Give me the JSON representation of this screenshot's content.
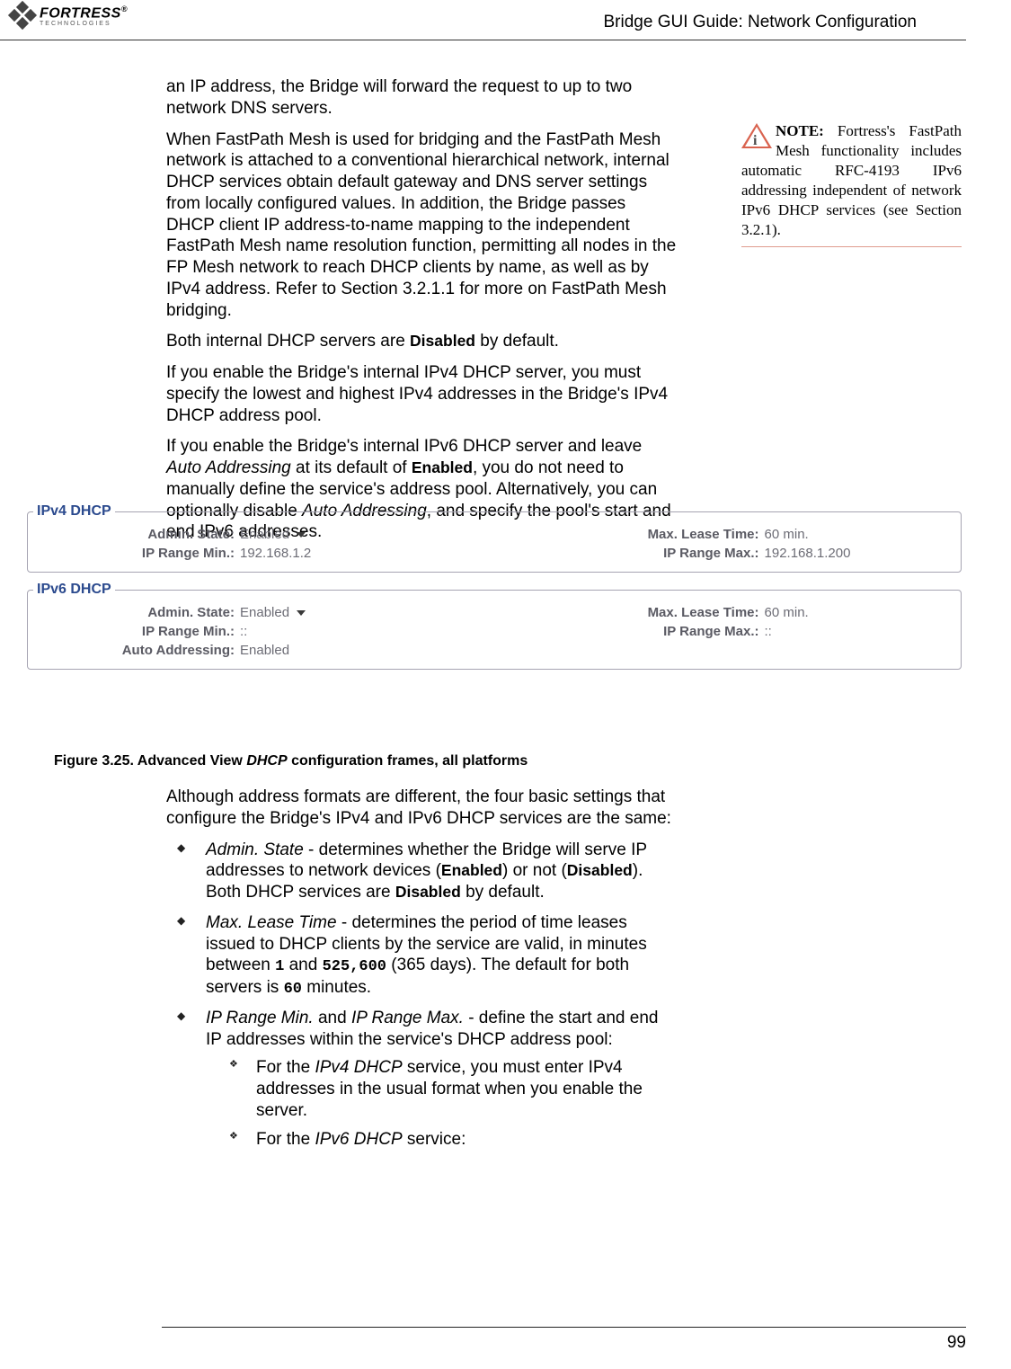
{
  "header": {
    "logo_main": "FORTRESS",
    "logo_sub": "TECHNOLOGIES",
    "title": "Bridge GUI Guide: Network Configuration"
  },
  "body": {
    "p1": "an IP address, the Bridge will forward the request to up to two network DNS servers.",
    "p2": "When FastPath Mesh is used for bridging and the FastPath Mesh network is attached to a conventional hierarchical network, internal DHCP services obtain default gateway and DNS server settings from locally configured values. In addition, the Bridge passes DHCP client IP address-to-name mapping to the independent FastPath Mesh name resolution function, permitting all nodes in the FP Mesh network to reach DHCP clients by name, as well as by IPv4 address. Refer to Section 3.2.1.1 for more on FastPath Mesh bridging.",
    "p3_a": "Both internal DHCP servers are ",
    "p3_b": "Disabled",
    "p3_c": " by default.",
    "p4": "If you enable the Bridge's internal IPv4 DHCP server, you must specify the lowest and highest IPv4 addresses in the Bridge's IPv4 DHCP address pool.",
    "p5_a": "If you enable the Bridge's internal IPv6 DHCP server and leave ",
    "p5_b": "Auto Addressing",
    "p5_c": " at its default of ",
    "p5_d": "Enabled",
    "p5_e": ", you do not need to manually define the service's address pool. Alternatively, you can optionally disable ",
    "p5_f": "Auto Addressing",
    "p5_g": ", and specify the pool's start and end IPv6 addresses."
  },
  "note": {
    "label": "NOTE:",
    "text": " Fortress's FastPath Mesh functionality includes automatic RFC-4193 IPv6 addressing independent of network IPv6 DHCP services (see Section 3.2.1)."
  },
  "dhcp4": {
    "legend": "IPv4 DHCP",
    "admin_label": "Admin. State:",
    "admin_value": "Enabled",
    "lease_label": "Max. Lease Time:",
    "lease_value": "60 min.",
    "min_label": "IP Range Min.:",
    "min_value": "192.168.1.2",
    "max_label": "IP Range Max.:",
    "max_value": "192.168.1.200"
  },
  "dhcp6": {
    "legend": "IPv6 DHCP",
    "admin_label": "Admin. State:",
    "admin_value": "Enabled",
    "lease_label": "Max. Lease Time:",
    "lease_value": "60 min.",
    "min_label": "IP Range Min.:",
    "min_value": "::",
    "max_label": "IP Range Max.:",
    "max_value": "::",
    "auto_label": "Auto Addressing:",
    "auto_value": "Enabled"
  },
  "caption_a": "Figure 3.25. Advanced View ",
  "caption_b": "DHCP",
  "caption_c": " configuration frames, all platforms",
  "body2": {
    "p1": "Although address formats are different, the four basic settings that configure the Bridge's IPv4 and IPv6 DHCP services are the same:",
    "b1_a": "Admin. State",
    "b1_b": " - determines whether the Bridge will serve IP addresses to network devices (",
    "b1_c": "Enabled",
    "b1_d": ") or not (",
    "b1_e": "Disabled",
    "b1_f": "). Both DHCP services are ",
    "b1_g": "Disabled",
    "b1_h": " by default.",
    "b2_a": "Max. Lease Time",
    "b2_b": " - determines the period of time leases issued to DHCP clients by the service are valid, in minutes between ",
    "b2_c": "1",
    "b2_d": " and ",
    "b2_e": "525,600",
    "b2_f": " (365 days). The default for both servers is ",
    "b2_g": "60",
    "b2_h": " minutes.",
    "b3_a": "IP Range Min.",
    "b3_b": " and ",
    "b3_c": "IP Range Max.",
    "b3_d": " - define the start and end IP addresses within the service's DHCP address pool:",
    "s1_a": "For the ",
    "s1_b": "IPv4 DHCP",
    "s1_c": " service, you must enter IPv4 addresses in the usual format when you enable the server.",
    "s2_a": "For the ",
    "s2_b": "IPv6 DHCP",
    "s2_c": " service:"
  },
  "page_num": "99"
}
